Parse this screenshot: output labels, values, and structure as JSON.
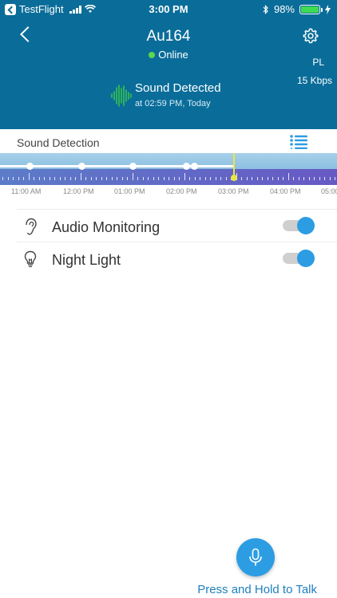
{
  "status_bar": {
    "back_app": "TestFlight",
    "time": "3:00 PM",
    "battery": "98%",
    "battery_level": 0.98
  },
  "header": {
    "title": "Au164",
    "status": "Online",
    "quality": "PL",
    "bitrate": "15 Kbps",
    "event_title": "Sound Detected",
    "event_time": "at 02:59 PM, Today"
  },
  "detection": {
    "label": "Sound Detection",
    "timeline_labels": [
      "11:00 AM",
      "12:00 PM",
      "01:00 PM",
      "02:00 PM",
      "03:00 PM",
      "04:00 PM",
      "05:00"
    ]
  },
  "settings": [
    {
      "label": "Audio Monitoring",
      "icon": "ear-icon",
      "enabled": true
    },
    {
      "label": "Night Light",
      "icon": "lightbulb-icon",
      "enabled": true
    }
  ],
  "talk": {
    "label": "Press and Hold to Talk"
  },
  "colors": {
    "header_bg": "#0a6d99",
    "accent": "#2c9de3",
    "online": "#5dd84a",
    "sound_wave": "#37c44a",
    "cursor": "#e8e642"
  }
}
